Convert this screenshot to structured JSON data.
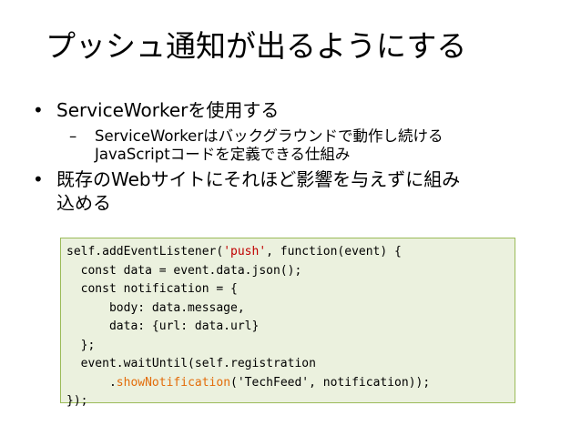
{
  "slide": {
    "title": "プッシュ通知が出るようにする",
    "bullets": [
      {
        "marker": "•",
        "text": "ServiceWorkerを使用する",
        "sub": [
          {
            "marker": "–",
            "line1": "ServiceWorkerはバックグラウンドで動作し続ける",
            "line2": "JavaScriptコードを定義できる仕組み"
          }
        ]
      },
      {
        "marker": "•",
        "line1": "既存のWebサイトにそれほど影響を与えずに組み",
        "line2": "込める"
      }
    ],
    "code": {
      "l1_a": "self.addEventListener(",
      "l1_str": "'push'",
      "l1_b": ", function(event) {",
      "l2": "  const data = event.data.json();",
      "l3": "  const notification = {",
      "l4": "      body: data.message,",
      "l5": "      data: {url: data.url}",
      "l6": "  };",
      "l7": "  event.waitUntil(self.registration",
      "l8_a": "      .",
      "l8_fn": "showNotification",
      "l8_b": "('TechFeed', notification));",
      "l9": "});"
    },
    "colors": {
      "code_background": "#ebf1de",
      "code_border": "#9bbb59",
      "string_color": "#c00000",
      "function_color": "#e36c09"
    }
  }
}
